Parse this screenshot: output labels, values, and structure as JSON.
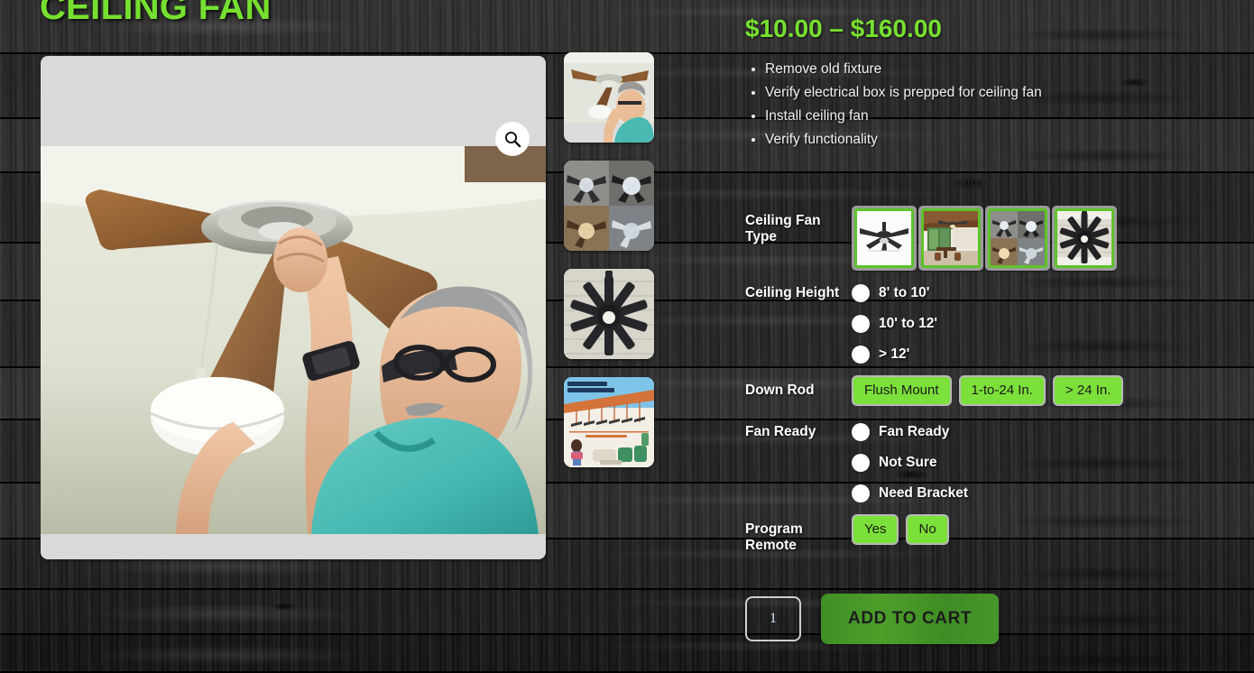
{
  "product": {
    "title": "CEILING FAN",
    "price_range": "$10.00 – $160.00",
    "variation_description": "Exterior\nCeiling Fan",
    "short_description": [
      "Remove old fixture",
      "Verify electrical box is prepped for ceiling fan",
      "Install ceiling fan",
      "Verify functionality"
    ]
  },
  "gallery": {
    "zoom_icon": "magnifier-icon",
    "main_image_alt": "Man in teal shirt installing a ceiling fan light cover",
    "thumbnails": [
      {
        "alt": "Man installing ceiling fan light cover"
      },
      {
        "alt": "Grid of four crystal-light ceiling fans"
      },
      {
        "alt": "Large black windmill ceiling fan"
      },
      {
        "alt": "Ceiling Fan Downrod Guide infographic"
      }
    ]
  },
  "variations": [
    {
      "label": "Ceiling Fan Type",
      "type": "image-swatch",
      "options": [
        {
          "alt": "Standard black ceiling fan on white background",
          "selected": true
        },
        {
          "alt": "Outdoor patio ceiling fan over dining table",
          "selected": true
        },
        {
          "alt": "Crystal light kit ceiling fans collage",
          "selected": true
        },
        {
          "alt": "Large black windmill ceiling fan",
          "selected": true
        }
      ]
    },
    {
      "label": "Ceiling Height",
      "type": "radio",
      "options": [
        {
          "label": "8' to 10'",
          "selected": false
        },
        {
          "label": "10' to 12'",
          "selected": false
        },
        {
          "label": "> 12'",
          "selected": false
        }
      ]
    },
    {
      "label": "Down Rod",
      "type": "button",
      "options": [
        {
          "label": "Flush Mount",
          "selected": false
        },
        {
          "label": "1-to-24 In.",
          "selected": false
        },
        {
          "label": "> 24 In.",
          "selected": false
        }
      ]
    },
    {
      "label": "Fan Ready",
      "type": "radio",
      "options": [
        {
          "label": "Fan Ready",
          "selected": false
        },
        {
          "label": "Not Sure",
          "selected": false
        },
        {
          "label": "Need Bracket",
          "selected": false
        }
      ]
    },
    {
      "label": "Program Remote",
      "type": "button",
      "options": [
        {
          "label": "Yes",
          "selected": false
        },
        {
          "label": "No",
          "selected": false
        }
      ]
    }
  ],
  "cart": {
    "quantity": "1",
    "add_to_cart_label": "ADD TO CART"
  },
  "colors": {
    "accent_green": "#76e030",
    "button_green": "#7ce03a",
    "cart_green": "#47962a",
    "background": "#2a2a2a",
    "image_frame": "#d9d9d9"
  }
}
